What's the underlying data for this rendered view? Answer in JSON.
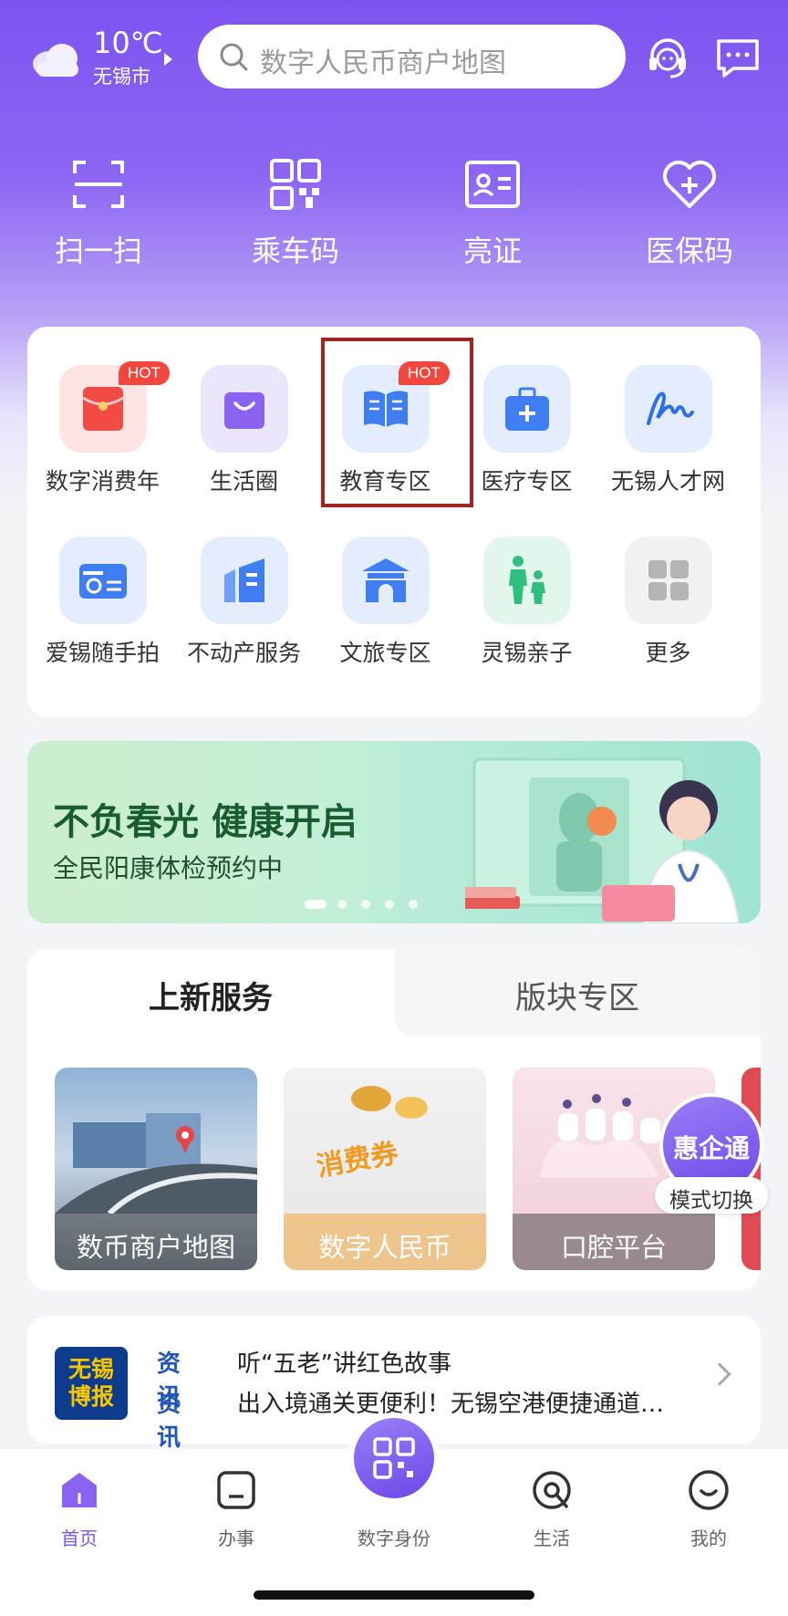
{
  "weather": {
    "temperature": "10℃",
    "city": "无锡市",
    "icon": "cloud-icon"
  },
  "search": {
    "placeholder": "数字人民币商户地图"
  },
  "header_icons": [
    "customer-service-icon",
    "message-icon"
  ],
  "quick_actions": [
    {
      "label": "扫一扫",
      "icon": "scan-icon"
    },
    {
      "label": "乘车码",
      "icon": "qr-code-icon"
    },
    {
      "label": "亮证",
      "icon": "id-card-icon"
    },
    {
      "label": "医保码",
      "icon": "heart-plus-icon"
    }
  ],
  "services": [
    {
      "label": "数字消费年",
      "icon": "red-envelope-icon",
      "badge": "HOT",
      "color": "#f24a44"
    },
    {
      "label": "生活圈",
      "icon": "shopping-bag-icon",
      "badge": "",
      "color": "#8b63f0"
    },
    {
      "label": "教育专区",
      "icon": "book-icon",
      "badge": "HOT",
      "color": "#3f7ef2"
    },
    {
      "label": "医疗专区",
      "icon": "medical-kit-icon",
      "badge": "",
      "color": "#3f7ef2"
    },
    {
      "label": "无锡人才网",
      "icon": "signature-icon",
      "badge": "",
      "color": "#2f6ee8"
    },
    {
      "label": "爱锡随手拍",
      "icon": "camera-icon",
      "badge": "",
      "color": "#3f7ef2"
    },
    {
      "label": "不动产服务",
      "icon": "building-icon",
      "badge": "",
      "color": "#3f7ef2"
    },
    {
      "label": "文旅专区",
      "icon": "pavilion-icon",
      "badge": "",
      "color": "#3f7ef2"
    },
    {
      "label": "灵锡亲子",
      "icon": "parent-child-icon",
      "badge": "",
      "color": "#2fbe7e"
    },
    {
      "label": "更多",
      "icon": "grid-icon",
      "badge": "",
      "color": "#b5b5b5"
    }
  ],
  "banner": {
    "title": "不负春光 健康开启",
    "subtitle": "全民阳康体检预约中"
  },
  "new_services": {
    "tabs": [
      {
        "label": "上新服务",
        "active": true
      },
      {
        "label": "版块专区",
        "active": false
      }
    ],
    "items": [
      {
        "label": "数币商户地图"
      },
      {
        "label": "数字人民币"
      },
      {
        "label": "口腔平台"
      }
    ],
    "voucher_text": "消费券"
  },
  "floating": {
    "title": "惠企通",
    "subtitle": "模式切换"
  },
  "news": {
    "logo_line1": "无锡",
    "logo_line2": "博报",
    "items": [
      {
        "tag": "资讯",
        "text": "听“五老”讲红色故事"
      },
      {
        "tag": "资讯",
        "text": "出入境通关更便利！无锡空港便捷通道…"
      }
    ]
  },
  "bottom_nav": [
    {
      "label": "首页",
      "icon": "home-icon",
      "active": true
    },
    {
      "label": "办事",
      "icon": "tasks-icon",
      "active": false
    },
    {
      "label": "数字身份",
      "icon": "qr-code-icon",
      "active": false
    },
    {
      "label": "生活",
      "icon": "life-icon",
      "active": false
    },
    {
      "label": "我的",
      "icon": "smile-icon",
      "active": false
    }
  ],
  "colors": {
    "brand": "#7e53f2",
    "accent_blue": "#3f7ef2",
    "hot_red": "#f0463d"
  }
}
